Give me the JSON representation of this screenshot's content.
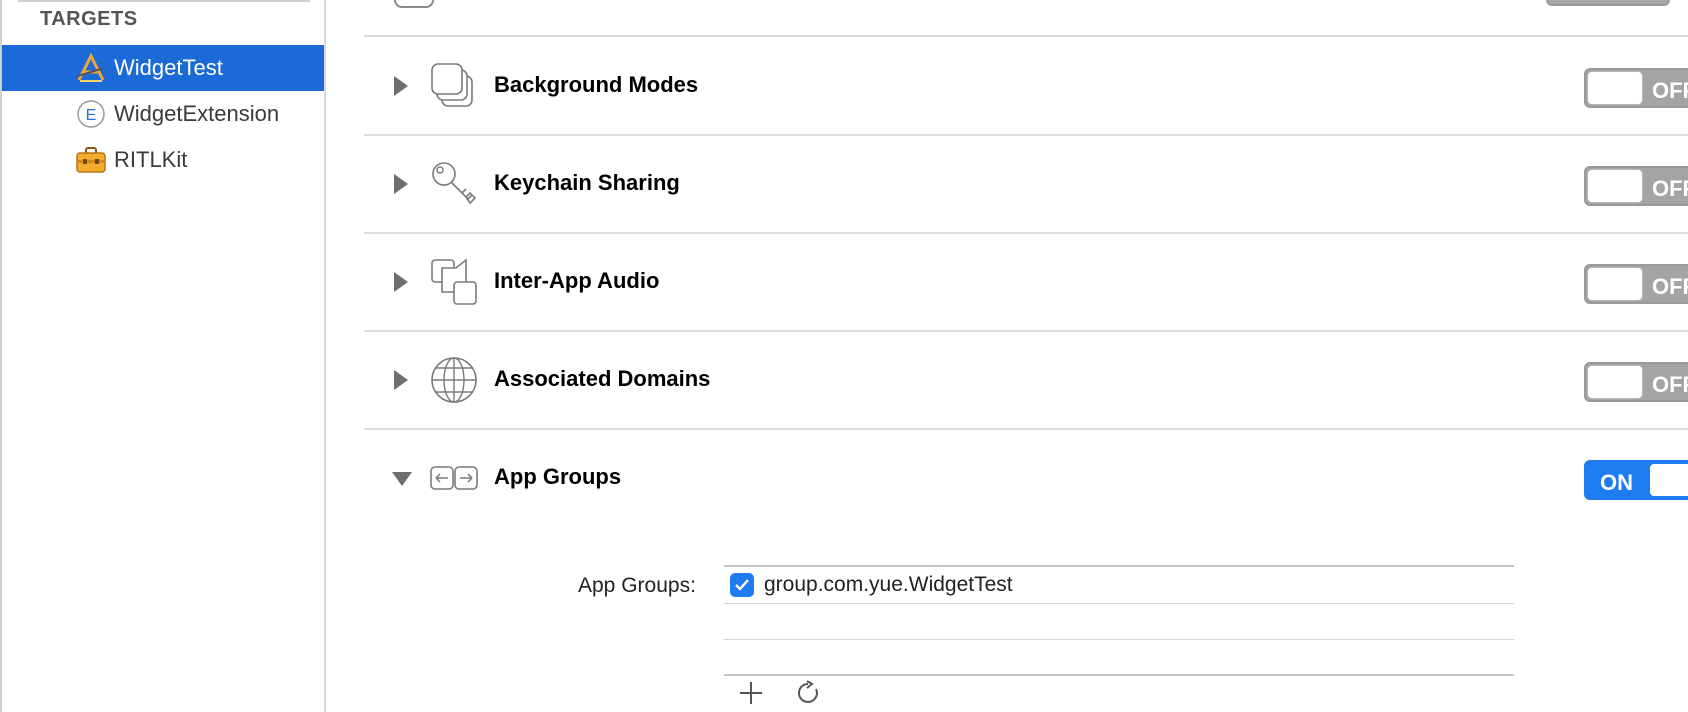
{
  "sidebar": {
    "header": "TARGETS",
    "items": [
      {
        "label": "WidgetTest",
        "icon": "app-target-icon",
        "selected": true
      },
      {
        "label": "WidgetExtension",
        "icon": "extension-icon",
        "selected": false
      },
      {
        "label": "RITLKit",
        "icon": "framework-toolbox-icon",
        "selected": false
      }
    ]
  },
  "capabilities": [
    {
      "title": "Background Modes",
      "icon": "background-modes-icon",
      "state": "OFF",
      "expanded": false
    },
    {
      "title": "Keychain Sharing",
      "icon": "key-icon",
      "state": "OFF",
      "expanded": false
    },
    {
      "title": "Inter-App Audio",
      "icon": "inter-app-audio-icon",
      "state": "OFF",
      "expanded": false
    },
    {
      "title": "Associated Domains",
      "icon": "globe-icon",
      "state": "OFF",
      "expanded": false
    },
    {
      "title": "App Groups",
      "icon": "app-groups-icon",
      "state": "ON",
      "expanded": true
    }
  ],
  "app_groups": {
    "label": "App Groups:",
    "entries": [
      {
        "name": "group.com.yue.WidgetTest",
        "checked": true
      }
    ],
    "add_icon": "plus-icon",
    "refresh_icon": "refresh-icon"
  },
  "colors": {
    "selection": "#1c6ad8",
    "switch_on": "#1f7bf0",
    "switch_off": "#a4a4a4"
  }
}
